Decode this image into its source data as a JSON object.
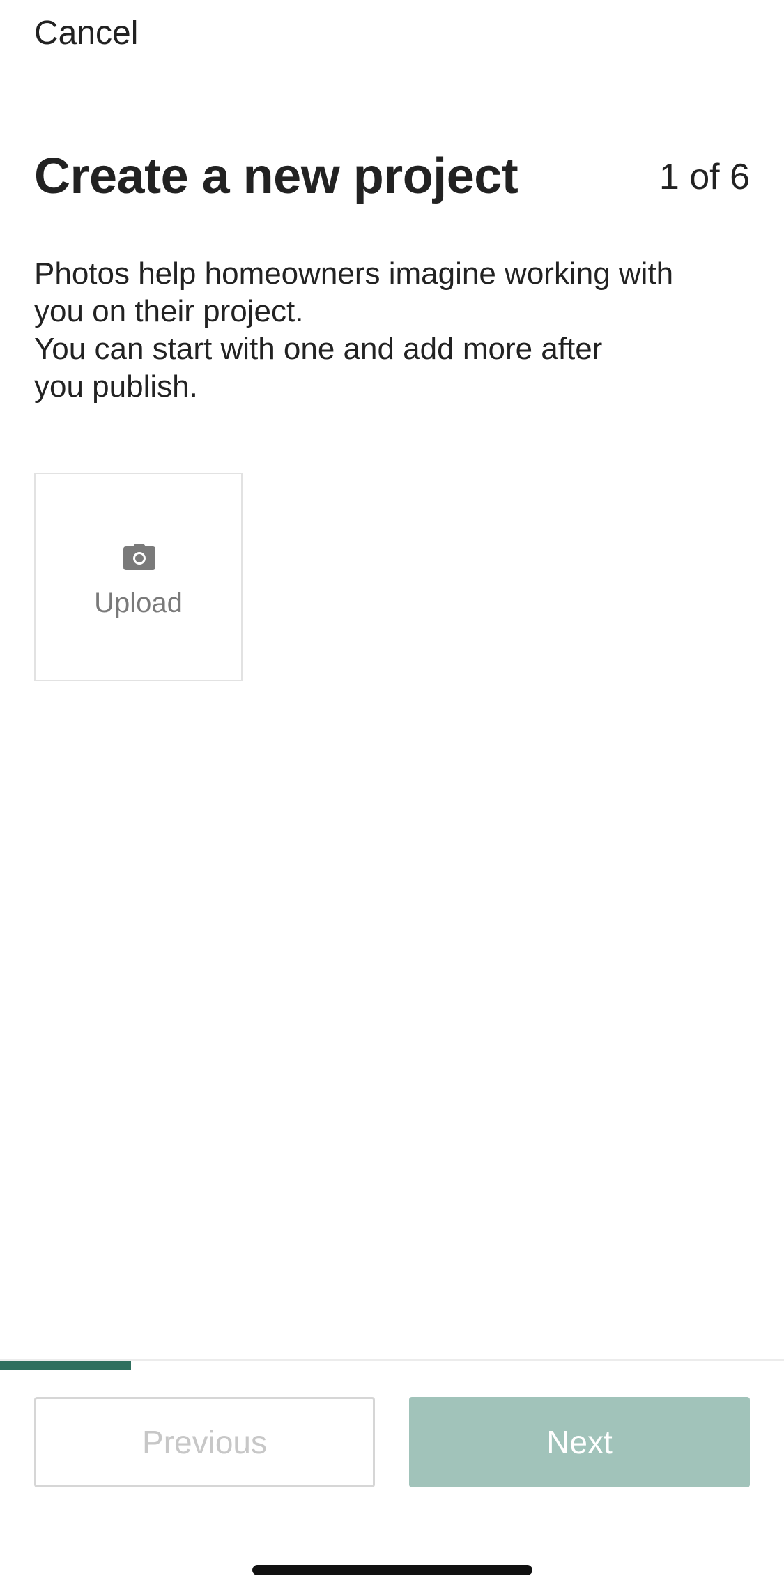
{
  "header": {
    "cancel_label": "Cancel",
    "title": "Create a new project",
    "step_indicator": "1 of 6"
  },
  "description": {
    "paragraph_1": "Photos help homeowners imagine working with\nyou on their project.",
    "paragraph_2": "You can start with one and add more after\nyou publish."
  },
  "upload": {
    "label": "Upload",
    "icon": "camera-icon"
  },
  "progress": {
    "current_step": 1,
    "total_steps": 6,
    "fraction": 0.1667
  },
  "footer": {
    "previous_label": "Previous",
    "next_label": "Next"
  },
  "colors": {
    "accent": "#2f6f5e",
    "next_button_disabled": "#a1c3ba",
    "text": "#222222",
    "muted_text": "#7a7a7a"
  }
}
